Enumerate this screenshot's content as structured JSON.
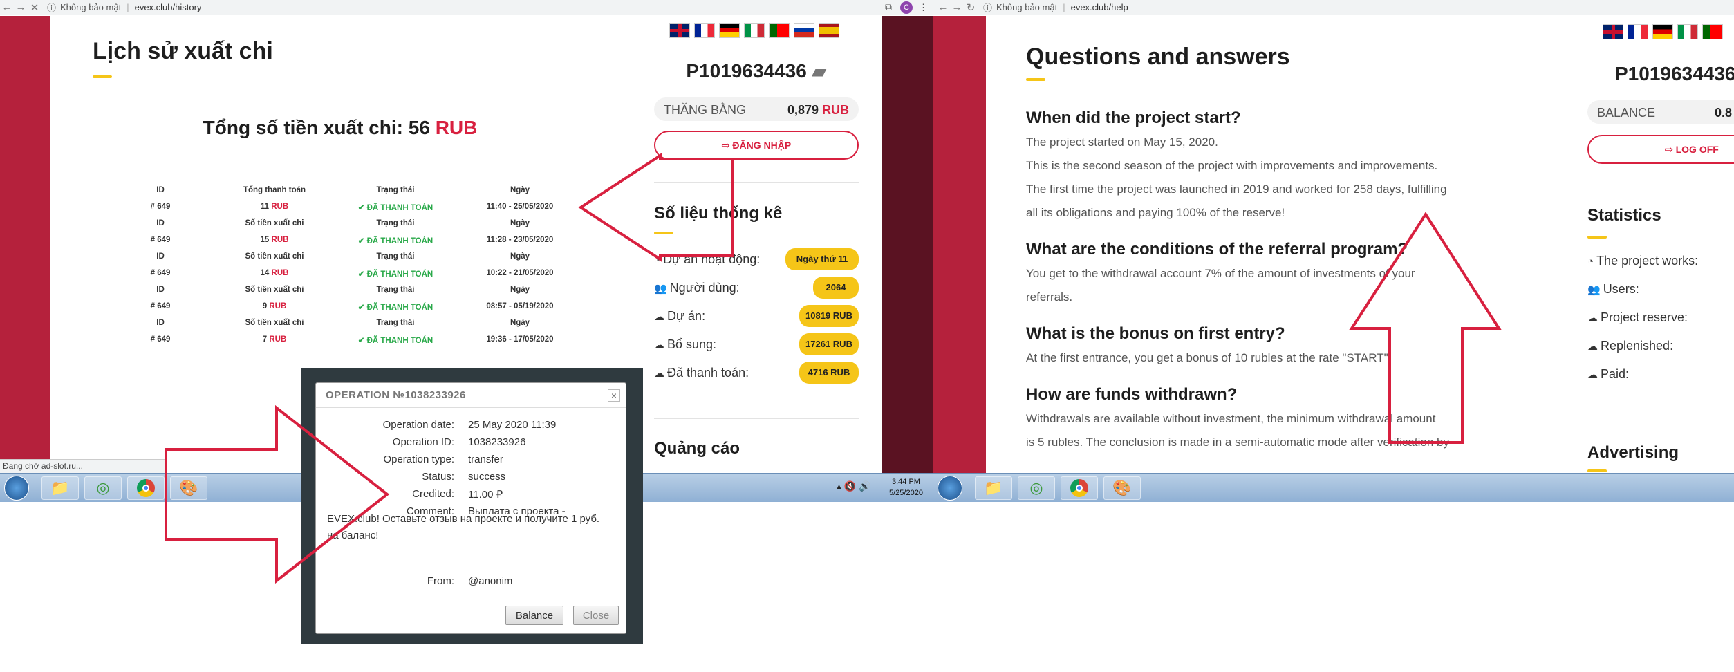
{
  "left_browser": {
    "status_label": "Không bảo mật",
    "url": "evex.club/history"
  },
  "right_browser": {
    "status_label": "Không bảo mật",
    "url": "evex.club/help"
  },
  "history": {
    "title": "Lịch sử xuất chi",
    "total_label": "Tổng số tiền xuất chi: 56",
    "total_currency": "RUB",
    "rows": [
      {
        "h_id": "ID",
        "h_amount": "Tổng thanh toán",
        "h_status": "Trạng thái",
        "h_date": "Ngày",
        "id": "# 649",
        "amount": "11",
        "cur": "RUB",
        "status": "✔ ĐÃ THANH TOÁN",
        "date": "11:40 - 25/05/2020"
      },
      {
        "h_id": "ID",
        "h_amount": "Số tiền xuất chi",
        "h_status": "Trạng thái",
        "h_date": "Ngày",
        "id": "# 649",
        "amount": "15",
        "cur": "RUB",
        "status": "✔ ĐÃ THANH TOÁN",
        "date": "11:28 - 23/05/2020"
      },
      {
        "h_id": "ID",
        "h_amount": "Số tiền xuất chi",
        "h_status": "Trạng thái",
        "h_date": "Ngày",
        "id": "# 649",
        "amount": "14",
        "cur": "RUB",
        "status": "✔ ĐÃ THANH TOÁN",
        "date": "10:22 - 21/05/2020"
      },
      {
        "h_id": "ID",
        "h_amount": "Số tiền xuất chi",
        "h_status": "Trạng thái",
        "h_date": "Ngày",
        "id": "# 649",
        "amount": "9",
        "cur": "RUB",
        "status": "✔ ĐÃ THANH TOÁN",
        "date": "08:57 - 05/19/2020"
      },
      {
        "h_id": "ID",
        "h_amount": "Số tiền xuất chi",
        "h_status": "Trạng thái",
        "h_date": "Ngày",
        "id": "# 649",
        "amount": "7",
        "cur": "RUB",
        "status": "✔ ĐÃ THANH TOÁN",
        "date": "19:36 - 17/05/2020"
      }
    ]
  },
  "left_sidebar": {
    "account": "P1019634436",
    "balance_label": "THĂNG BẰNG",
    "balance_value": "0,879",
    "balance_currency": "RUB",
    "login_button": "⇨ ĐĂNG NHẬP",
    "stats_title": "Số liệu thống kê",
    "stats": [
      {
        "label": "Dự án hoạt động:",
        "value": "Ngày thứ 11"
      },
      {
        "label": "Người dùng:",
        "value": "2064"
      },
      {
        "label": "Dự án:",
        "value": "10819 RUB"
      },
      {
        "label": "Bổ sung:",
        "value": "17261 RUB"
      },
      {
        "label": "Đã thanh toán:",
        "value": "4716 RUB"
      }
    ],
    "ads_title": "Quảng cáo"
  },
  "status_bar": "Đang chờ ad-slot.ru...",
  "modal": {
    "title": "OPERATION №1038233926",
    "close": "×",
    "rows": [
      {
        "label": "Operation date:",
        "value": "25 May 2020 11:39"
      },
      {
        "label": "Operation ID:",
        "value": "1038233926"
      },
      {
        "label": "Operation type:",
        "value": "transfer"
      },
      {
        "label": "Status:",
        "value": "success"
      },
      {
        "label": "Credited:",
        "value": "11.00 ₽"
      },
      {
        "label": "Comment:",
        "value": "Выплата с проекта -"
      }
    ],
    "comment_cont1": "EVEX.club! Оставьте отзыв на проекте и получите 1 руб.",
    "comment_cont2": "на баланс!",
    "from_label": "From:",
    "from_value": "@anonim",
    "balance_btn": "Balance",
    "close_btn": "Close"
  },
  "clock": {
    "time": "3:44 PM",
    "date": "5/25/2020"
  },
  "help": {
    "title": "Questions and answers",
    "qa": [
      {
        "q": "When did the project start?",
        "a": [
          "The project started on May 15, 2020.",
          "This is the second season of the project with improvements and improvements.",
          "The first time the project was launched in 2019 and worked for 258 days, fulfilling",
          "all its obligations and paying 100% of the reserve!"
        ]
      },
      {
        "q": "What are the conditions of the referral program?",
        "a": [
          "You get to the withdrawal account 7% of the amount of investments of your",
          "referrals."
        ]
      },
      {
        "q": "What is the bonus on first entry?",
        "a": [
          "At the first entrance, you get a bonus of 10 rubles at the rate \"START\"."
        ]
      },
      {
        "q": "How are funds withdrawn?",
        "a": [
          "Withdrawals are available without investment, the minimum withdrawal amount",
          "is 5 rubles. The conclusion is made in a semi-automatic mode after verification by"
        ]
      }
    ]
  },
  "right_sidebar": {
    "account": "P1019634436",
    "balance_label": "BALANCE",
    "balance_value": "0.8",
    "logoff_button": "⇨ LOG OFF",
    "stats_title": "Statistics",
    "stats": [
      "The project works:",
      "Users:",
      "Project reserve:",
      "Replenished:",
      "Paid:"
    ],
    "ads_title": "Advertising"
  }
}
